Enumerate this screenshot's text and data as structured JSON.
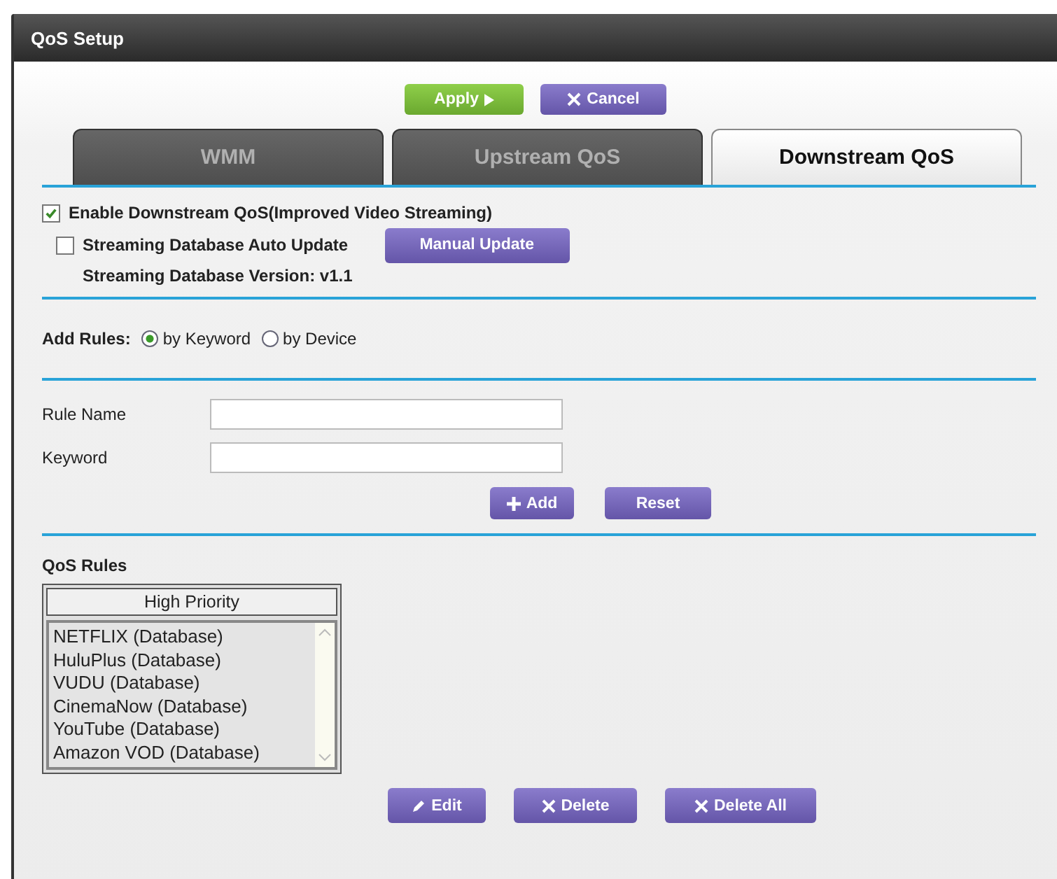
{
  "window": {
    "title": "QoS Setup"
  },
  "actions": [
    {
      "label": "Apply",
      "kind": "apply"
    },
    {
      "label": "Cancel",
      "kind": "cancel"
    }
  ],
  "tabs": [
    {
      "label": "WMM",
      "selected": false
    },
    {
      "label": "Upstream QoS",
      "selected": false
    },
    {
      "label": "Downstream QoS",
      "selected": true
    }
  ],
  "enable_downstream": {
    "label": "Enable Downstream QoS(Improved Video Streaming)",
    "checked": true
  },
  "auto_update": {
    "label": "Streaming Database Auto Update",
    "checked": false
  },
  "manual_update_button": "Manual Update",
  "database_version": "Streaming Database Version: v1.1",
  "add_rules": {
    "label": "Add Rules:",
    "options": [
      {
        "label": "by Keyword",
        "selected": true
      },
      {
        "label": "by Device",
        "selected": false
      }
    ]
  },
  "fields": [
    {
      "label": "Rule Name"
    },
    {
      "label": "Keyword"
    }
  ],
  "form_buttons": [
    {
      "label": "Add",
      "kind": "add"
    },
    {
      "label": "Reset",
      "kind": "plain"
    }
  ],
  "qos_rules": {
    "title": "QoS Rules",
    "header": "High Priority",
    "items": [
      "NETFLIX (Database)",
      "HuluPlus (Database)",
      "VUDU (Database)",
      "CinemaNow (Database)",
      "YouTube (Database)",
      "Amazon VOD (Database)"
    ]
  },
  "rule_buttons": [
    {
      "label": "Edit",
      "kind": "edit"
    },
    {
      "label": "Delete",
      "kind": "delete"
    },
    {
      "label": "Delete All",
      "kind": "delete"
    }
  ]
}
